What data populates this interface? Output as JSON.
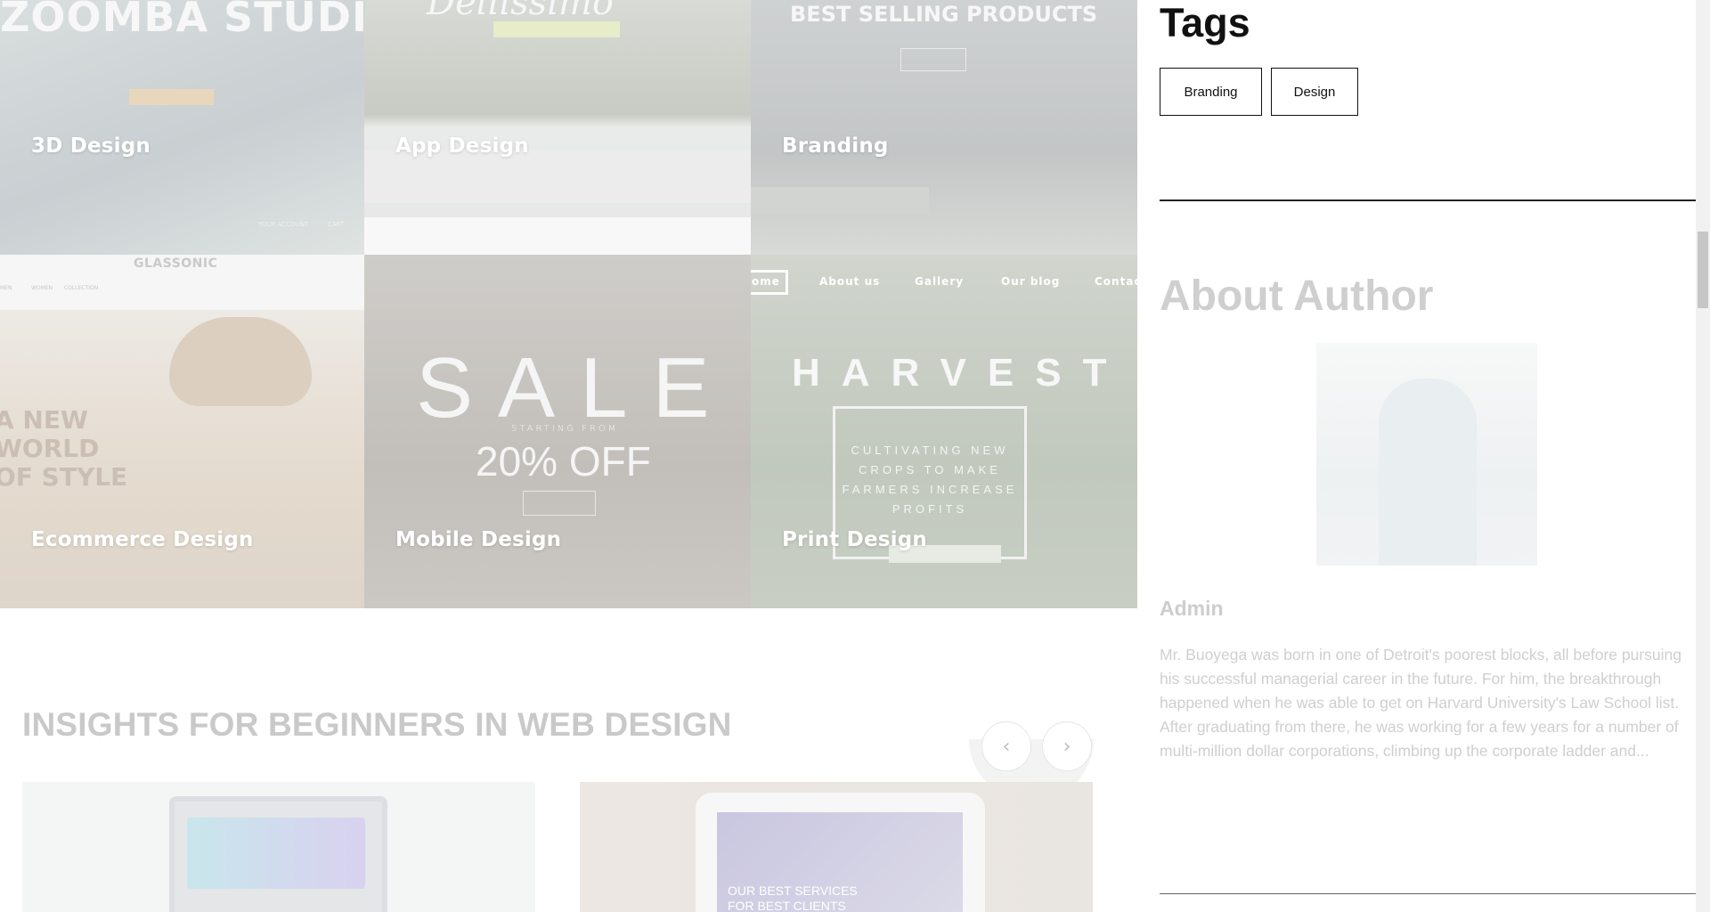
{
  "portfolio": {
    "tiles": [
      {
        "caption": "3D Design",
        "art_title": "ZOOMBA STUDIO",
        "art_links": [
          "YOUR ACCOUNT",
          "CART"
        ]
      },
      {
        "caption": "App Design",
        "art_title": "Deliissimo"
      },
      {
        "caption": "Branding",
        "art_title": "BEST SELLING PRODUCTS"
      },
      {
        "caption": "Ecommerce Design",
        "art_title": "GLASSONIC",
        "art_menu": [
          "MEN",
          "WOMEN",
          "COLLECTION"
        ],
        "art_lines": [
          "A NEW",
          "WORLD",
          "OF STYLE"
        ]
      },
      {
        "caption": "Mobile Design",
        "art_big": "SALE",
        "art_small": "STARTING FROM",
        "art_offer": "20% OFF"
      },
      {
        "caption": "Print Design",
        "art_nav": [
          "Home",
          "About us",
          "Gallery",
          "Our blog",
          "Contact"
        ],
        "art_title": "HARVEST",
        "art_lines": [
          "CULTIVATING NEW",
          "CROPS TO MAKE",
          "FARMERS INCREASE",
          "PROFITS"
        ]
      }
    ]
  },
  "insights": {
    "title": "INSIGHTS FOR BEGINNERS IN WEB DESIGN",
    "prev_icon": "chevron-left-icon",
    "next_icon": "chevron-right-icon",
    "card2_text": [
      "OUR BEST SERVICES",
      "FOR BEST CLIENTS"
    ]
  },
  "sidebar": {
    "tags_title": "Tags",
    "tags": [
      "Branding",
      "Design"
    ],
    "about_title": "About Author",
    "author_name": "Admin",
    "author_bio": "Mr. Buoyega was born in one of Detroit's poorest blocks, all before pursuing his successful managerial career in the future. For him, the breakthrough happened when he was able to get on Harvard University's Law School list. After graduating from there, he was working for a few years for a number of multi-million dollar corporations, climbing up the corporate ladder and..."
  },
  "colors": {
    "heading_dark": "#111111",
    "faded_text": "#cfcfcf",
    "tag_border": "#111111"
  }
}
